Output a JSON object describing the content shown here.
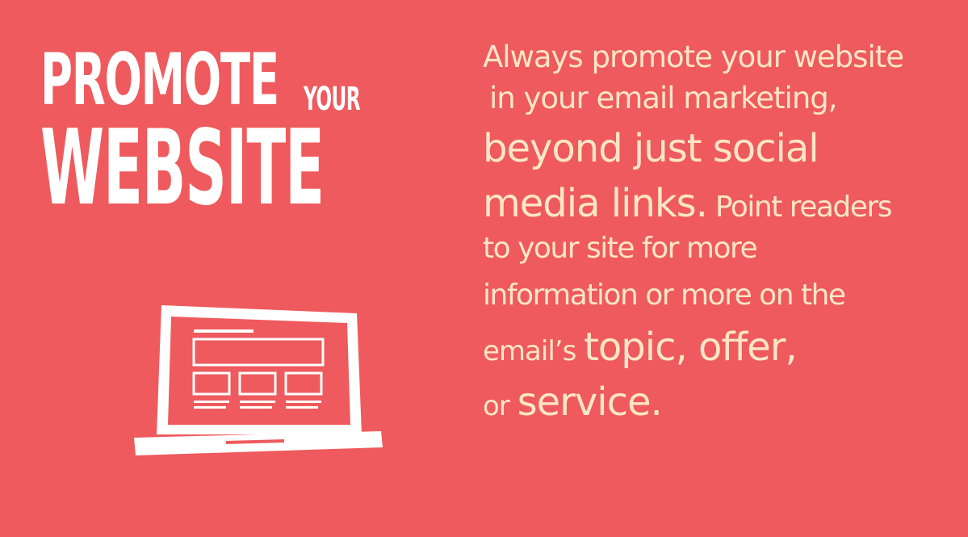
{
  "headline": {
    "promote": "PROMOTE",
    "your": "YOUR",
    "website": "WEBSITE"
  },
  "illustration": {
    "icon": "laptop-website-icon"
  },
  "body_text": {
    "line1": "Always promote your website",
    "line2": "in your email marketing,",
    "line3": "beyond just social",
    "line4_big": "media links.",
    "line4_small": " Point readers",
    "line5": "to your site for more",
    "line6": "information or more on the",
    "line7_small": "email’s ",
    "line7_big1": "topic,",
    "line7_big2": " offer,",
    "line8_small": "or ",
    "line8_big": "service."
  },
  "colors": {
    "background": "#ee5a5d",
    "headline": "#ffffff",
    "body_text": "#fde6c6"
  }
}
